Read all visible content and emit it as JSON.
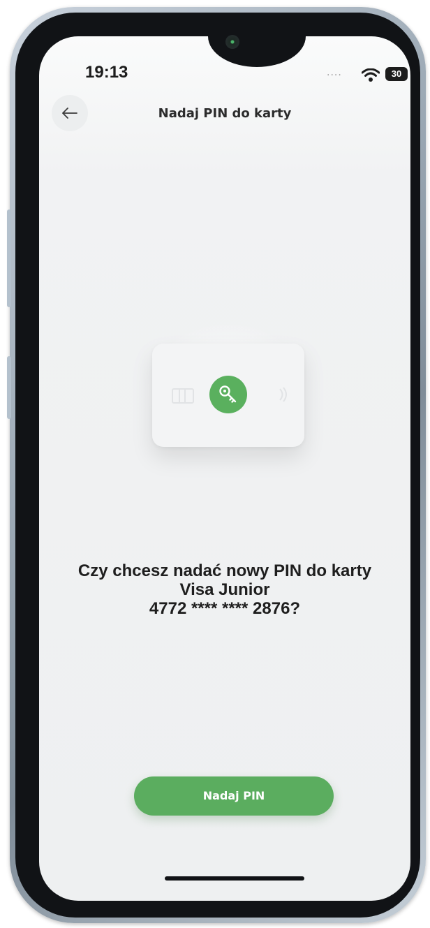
{
  "status_bar": {
    "time": "19:13",
    "dots": "....",
    "battery": "30"
  },
  "header": {
    "back_icon": "arrow-left-icon",
    "title": "Nadaj PIN do karty"
  },
  "illustration": {
    "icons": [
      "chip-icon",
      "key-icon",
      "contactless-icon"
    ],
    "accent": "#5ab05e"
  },
  "question": {
    "line1": "Czy chcesz nadać nowy PIN do karty",
    "line2": "Visa Junior",
    "line3": "4772 **** **** 2876?"
  },
  "actions": {
    "primary_label": "Nadaj PIN",
    "primary_color": "#5bad5f"
  }
}
